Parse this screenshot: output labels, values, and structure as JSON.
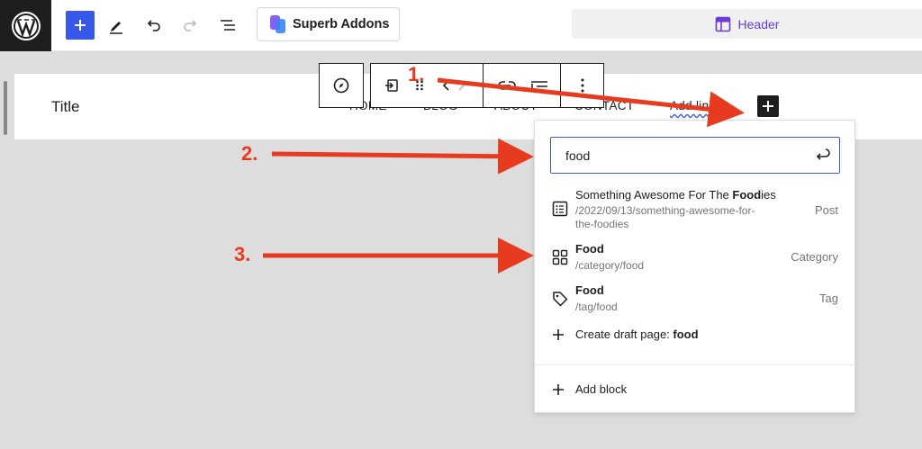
{
  "topbar": {
    "superb_label": "Superb Addons",
    "header_label": "Header",
    "colors": {
      "accent": "#3858e9",
      "template": "#6a3ad8",
      "dark": "#1e1e1e"
    }
  },
  "canvas": {
    "site_title": "Title",
    "nav": [
      "HOME",
      "BLOG",
      "ABOUT",
      "CONTACT"
    ],
    "add_link": "Add link"
  },
  "popover": {
    "search_value": "food",
    "results": [
      {
        "title_prefix": "Something Awesome For The ",
        "title_bold": "Food",
        "title_suffix": "ies",
        "url": "/2022/09/13/something-awesome-for-the-foodies",
        "type": "Post",
        "icon": "post-list-icon"
      },
      {
        "title_prefix": "",
        "title_bold": "Food",
        "title_suffix": "",
        "url": "/category/food",
        "type": "Category",
        "icon": "category-grid-icon"
      },
      {
        "title_prefix": "",
        "title_bold": "Food",
        "title_suffix": "",
        "url": "/tag/food",
        "type": "Tag",
        "icon": "tag-icon"
      }
    ],
    "draft_prefix": "Create draft page: ",
    "draft_value": "food",
    "add_block": "Add block"
  },
  "annotations": {
    "step1": "1.",
    "step2": "2.",
    "step3": "3.",
    "color": "#e63b1f"
  }
}
